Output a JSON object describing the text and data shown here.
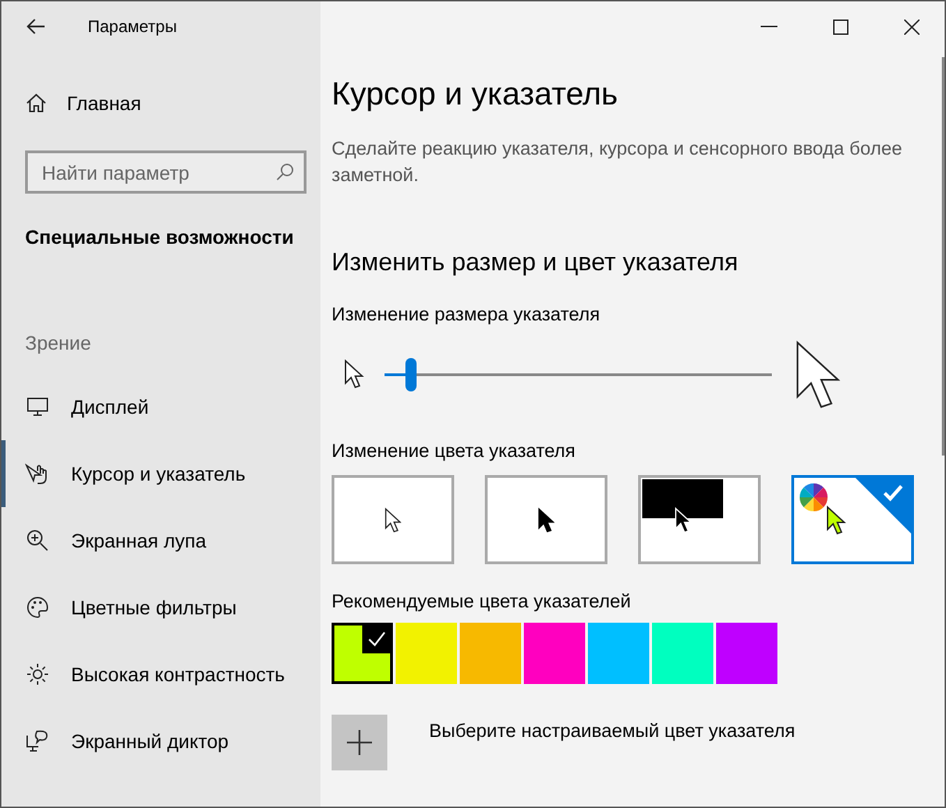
{
  "window": {
    "title": "Параметры"
  },
  "sidebar": {
    "home": "Главная",
    "search": {
      "placeholder": "Найти параметр"
    },
    "section": "Специальные возможности",
    "group": "Зрение",
    "items": [
      {
        "label": "Дисплей",
        "selected": false
      },
      {
        "label": "Курсор и указатель",
        "selected": true
      },
      {
        "label": "Экранная лупа",
        "selected": false
      },
      {
        "label": "Цветные фильтры",
        "selected": false
      },
      {
        "label": "Высокая контрастность",
        "selected": false
      },
      {
        "label": "Экранный диктор",
        "selected": false
      }
    ]
  },
  "page": {
    "title": "Курсор и указатель",
    "description": "Сделайте реакцию указателя, курсора и сенсорного ввода более заметной.",
    "heading": "Изменить размер и цвет указателя",
    "size": {
      "label": "Изменение размера указателя",
      "level": 0.07
    },
    "color": {
      "label": "Изменение цвета указателя",
      "styles": [
        {
          "kind": "white",
          "selected": false
        },
        {
          "kind": "black",
          "selected": false
        },
        {
          "kind": "inverted",
          "selected": false
        },
        {
          "kind": "custom",
          "selected": true
        }
      ]
    },
    "recommended": {
      "label": "Рекомендуемые цвета указателей",
      "swatches": [
        {
          "color": "#bfff00",
          "selected": true
        },
        {
          "color": "#f2f200",
          "selected": false
        },
        {
          "color": "#f7b900",
          "selected": false
        },
        {
          "color": "#ff00bf",
          "selected": false
        },
        {
          "color": "#00bfff",
          "selected": false
        },
        {
          "color": "#00ffbf",
          "selected": false
        },
        {
          "color": "#bf00ff",
          "selected": false
        }
      ]
    },
    "custom": {
      "label": "Выберите настраиваемый цвет указателя"
    }
  }
}
